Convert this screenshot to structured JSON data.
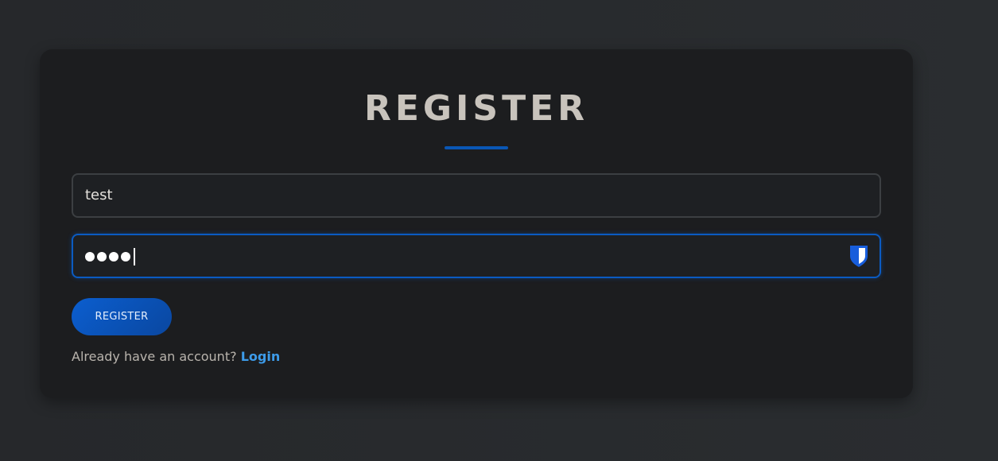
{
  "page": {
    "title": "REGISTER"
  },
  "form": {
    "username_value": "test",
    "password_masked_length": 4,
    "register_button_label": "REGISTER"
  },
  "footer": {
    "prompt": "Already have an account?",
    "login_link_label": "Login"
  },
  "icons": {
    "password_manager": "bitwarden-shield-icon"
  },
  "colors": {
    "accent": "#0b5bc2",
    "link": "#3d9be9",
    "card_background": "#1c1d1f",
    "page_background": "#282a2d",
    "title_text": "#c8c3bc"
  }
}
